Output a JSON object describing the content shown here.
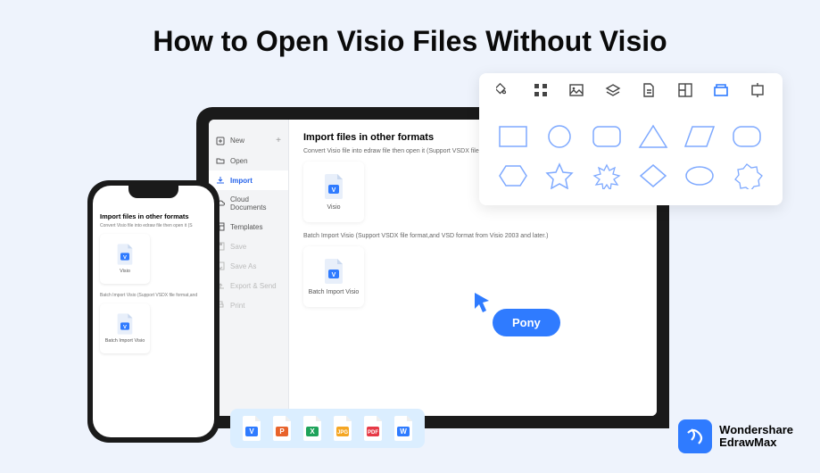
{
  "title": "How to Open Visio Files Without Visio",
  "laptop": {
    "sidebar": [
      {
        "label": "New",
        "icon": "plus-square",
        "hasPlus": true
      },
      {
        "label": "Open",
        "icon": "folder"
      },
      {
        "label": "Import",
        "icon": "download",
        "active": true
      },
      {
        "label": "Cloud Documents",
        "icon": "cloud"
      },
      {
        "label": "Templates",
        "icon": "template"
      },
      {
        "label": "Save",
        "icon": "save",
        "dim": true
      },
      {
        "label": "Save As",
        "icon": "saveas",
        "dim": true
      },
      {
        "label": "Export & Send",
        "icon": "export",
        "dim": true
      },
      {
        "label": "Print",
        "icon": "print",
        "dim": true
      }
    ],
    "heading": "Import files in other formats",
    "desc1": "Convert Visio file into edraw file then open it (Support VSDX file format)",
    "card1": "Visio",
    "desc2": "Batch Import Visio (Support VSDX file format,and VSD format from Visio 2003 and later.)",
    "card2": "Batch Import Visio"
  },
  "cursorButton": "Pony",
  "phone": {
    "heading": "Import files in other formats",
    "desc1": "Convert Visio file into edraw file then open it (S",
    "card1": "Visio",
    "desc2": "Batch Import Visio (Support VSDX file format,and",
    "card2": "Batch Import Visio"
  },
  "shapePanel": {
    "tools": [
      "fill-icon",
      "grid-icon",
      "image-icon",
      "layers-icon",
      "page-icon",
      "layout-icon",
      "shapes-icon",
      "crop-icon"
    ],
    "activeTool": 6,
    "shapes": [
      "rect",
      "circle",
      "roundrect",
      "triangle",
      "parallelogram",
      "roundrect2",
      "hexagon",
      "star",
      "burst",
      "diamond",
      "ellipse",
      "seal"
    ]
  },
  "formats": [
    {
      "label": "V",
      "bg": "#2f7bff"
    },
    {
      "label": "P",
      "bg": "#e8632b"
    },
    {
      "label": "X",
      "bg": "#1fa35a"
    },
    {
      "label": "JPG",
      "bg": "#f5a623"
    },
    {
      "label": "PDF",
      "bg": "#e63946"
    },
    {
      "label": "W",
      "bg": "#2f7bff"
    }
  ],
  "brand": {
    "line1": "Wondershare",
    "line2": "EdrawMax"
  }
}
